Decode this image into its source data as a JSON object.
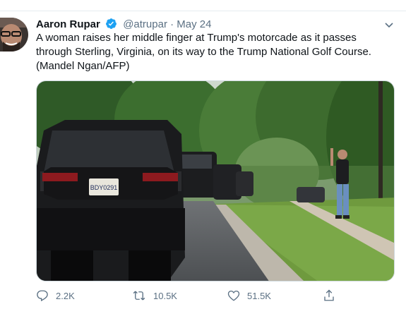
{
  "tweet": {
    "author_name": "Aaron Rupar",
    "verified": true,
    "handle": "@atrupar",
    "separator": "·",
    "date": "May 24",
    "text": "A woman raises her middle finger at Trump's motorcade as it passes through Sterling, Virginia, on its way to the Trump National Golf Course. (Mandel Ngan/AFP)",
    "license_plate": "BDY0291",
    "replies": "2.2K",
    "retweets": "10.5K",
    "likes": "51.5K"
  },
  "colors": {
    "verified": "#1da1f2",
    "muted": "#5b7083",
    "text": "#0f1419"
  },
  "icons": [
    "reply-icon",
    "retweet-icon",
    "like-icon",
    "share-icon",
    "more-caret-icon",
    "verified-badge-icon"
  ]
}
